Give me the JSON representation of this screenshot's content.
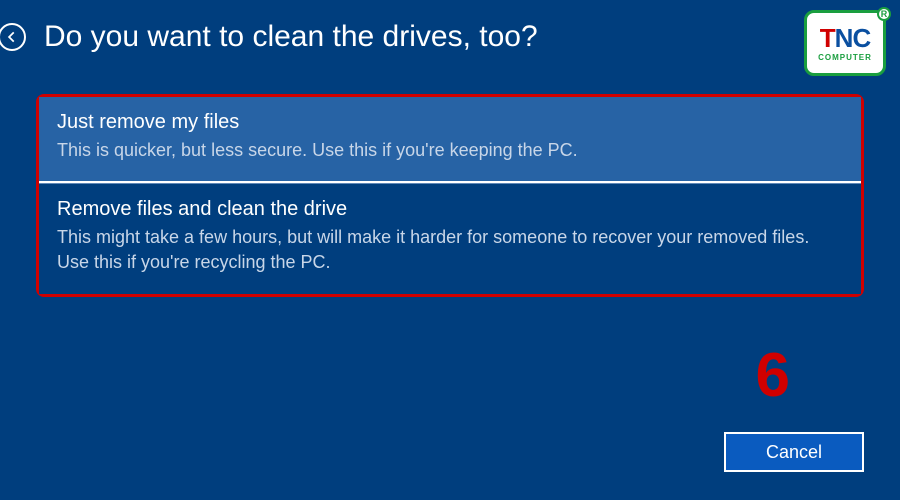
{
  "header": {
    "title": "Do you want to clean the drives, too?"
  },
  "options": [
    {
      "title": "Just remove my files",
      "description": "This is quicker, but less secure. Use this if you're keeping the PC."
    },
    {
      "title": "Remove files and clean the drive",
      "description": "This might take a few hours, but will make it harder for someone to recover your removed files. Use this if you're recycling the PC."
    }
  ],
  "annotation": {
    "step_number": "6"
  },
  "buttons": {
    "cancel": "Cancel"
  },
  "watermark": {
    "brand_t": "T",
    "brand_n": "N",
    "brand_c": "C",
    "subtitle": "COMPUTER",
    "registered": "R"
  }
}
